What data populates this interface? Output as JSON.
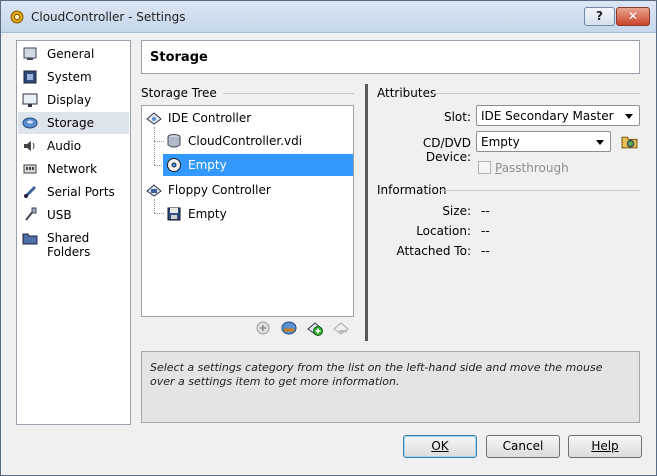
{
  "window": {
    "title": "CloudController - Settings",
    "help_label": "?",
    "close_label": "✕"
  },
  "sidebar": {
    "items": [
      {
        "label": "General",
        "icon": "general-icon",
        "selected": false
      },
      {
        "label": "System",
        "icon": "system-icon",
        "selected": false
      },
      {
        "label": "Display",
        "icon": "display-icon",
        "selected": false
      },
      {
        "label": "Storage",
        "icon": "storage-icon",
        "selected": true
      },
      {
        "label": "Audio",
        "icon": "audio-icon",
        "selected": false
      },
      {
        "label": "Network",
        "icon": "network-icon",
        "selected": false
      },
      {
        "label": "Serial Ports",
        "icon": "serial-ports-icon",
        "selected": false
      },
      {
        "label": "USB",
        "icon": "usb-icon",
        "selected": false
      },
      {
        "label": "Shared Folders",
        "icon": "shared-folders-icon",
        "selected": false
      }
    ]
  },
  "page": {
    "title": "Storage"
  },
  "storage_tree": {
    "label": "Storage Tree",
    "controllers": [
      {
        "label": "IDE Controller",
        "icon": "ide-controller-icon",
        "children": [
          {
            "label": "CloudController.vdi",
            "icon": "hard-disk-icon",
            "selected": false
          },
          {
            "label": "Empty",
            "icon": "cd-dvd-icon",
            "selected": true
          }
        ]
      },
      {
        "label": "Floppy Controller",
        "icon": "floppy-controller-icon",
        "children": [
          {
            "label": "Empty",
            "icon": "floppy-disk-icon",
            "selected": false
          }
        ]
      }
    ],
    "toolbar": [
      "add-attachment-icon",
      "add-controller-icon",
      "add-plus-icon",
      "remove-icon"
    ]
  },
  "attributes": {
    "label": "Attributes",
    "slot_label": "Slot:",
    "slot_value": "IDE Secondary Master",
    "device_label": "CD/DVD Device:",
    "device_value": "Empty",
    "passthrough_label": "Passthrough",
    "passthrough_checked": false
  },
  "information": {
    "label": "Information",
    "size_label": "Size:",
    "size_value": "--",
    "location_label": "Location:",
    "location_value": "--",
    "attached_label": "Attached To:",
    "attached_value": "--"
  },
  "description": "Select a settings category from the list on the left-hand side and move the mouse over a settings item to get more information.",
  "buttons": {
    "ok": "OK",
    "cancel": "Cancel",
    "help": "Help"
  },
  "colors": {
    "selection": "#3399ff",
    "sidebar_selected": "#dde4ec",
    "title_gradient": "#c5d7ec"
  }
}
